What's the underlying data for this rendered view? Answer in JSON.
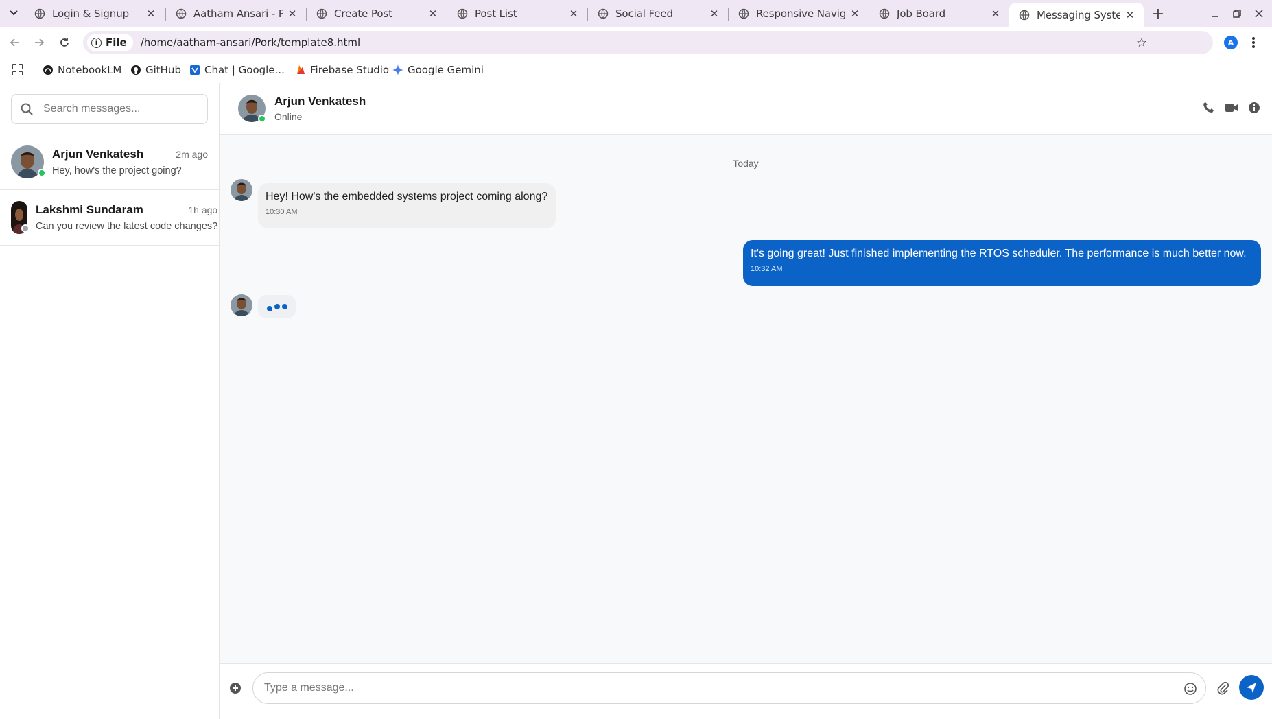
{
  "browser": {
    "tabs": [
      {
        "title": "Login & Signup"
      },
      {
        "title": "Aatham Ansari - Pro"
      },
      {
        "title": "Create Post"
      },
      {
        "title": "Post List"
      },
      {
        "title": "Social Feed"
      },
      {
        "title": "Responsive Navigat"
      },
      {
        "title": "Job Board"
      },
      {
        "title": "Messaging System"
      }
    ],
    "site_chip": "File",
    "url": "/home/aatham-ansari/Pork/template8.html",
    "profile_initial": "A",
    "bookmarks": [
      {
        "label": "NotebookLM",
        "icon": "notebooklm-icon"
      },
      {
        "label": "GitHub",
        "icon": "github-icon"
      },
      {
        "label": "Chat | Google...",
        "icon": "google-chat-icon"
      },
      {
        "label": "Firebase Studio",
        "icon": "firebase-icon"
      },
      {
        "label": "Google Gemini",
        "icon": "gemini-icon"
      }
    ]
  },
  "sidebar": {
    "search_placeholder": "Search messages...",
    "conversations": [
      {
        "name": "Arjun Venkatesh",
        "time": "2m ago",
        "preview": "Hey, how's the project going?",
        "status": "online"
      },
      {
        "name": "Lakshmi Sundaram",
        "time": "1h ago",
        "preview": "Can you review the latest code changes?",
        "status": "offline"
      }
    ]
  },
  "chat": {
    "contact_name": "Arjun Venkatesh",
    "contact_status": "Online",
    "day_label": "Today",
    "messages": [
      {
        "direction": "incoming",
        "text": "Hey! How's the embedded systems project coming along?",
        "time": "10:30 AM"
      },
      {
        "direction": "outgoing",
        "text": "It's going great! Just finished implementing the RTOS scheduler. The performance is much better now.",
        "time": "10:32 AM"
      }
    ],
    "typing_indicator": true,
    "composer_placeholder": "Type a message..."
  },
  "colors": {
    "accent": "#0b63c7",
    "online": "#22c55e",
    "offline": "#9ca3af",
    "tabstrip": "#f0e7f5"
  }
}
